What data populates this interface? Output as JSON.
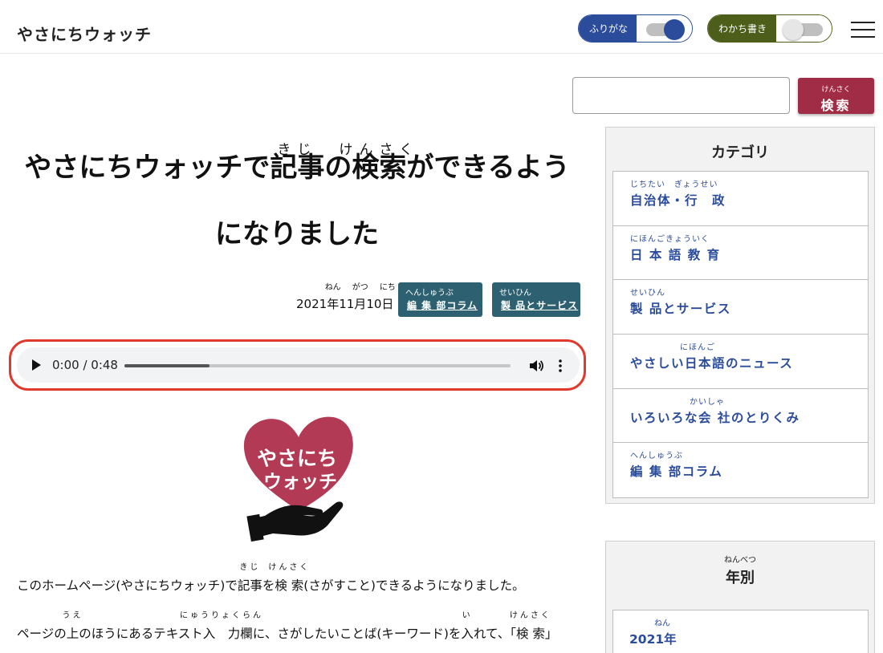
{
  "header": {
    "site_title": "やさにちウォッチ",
    "furigana_toggle": {
      "label": "ふりがな",
      "state": "on",
      "color": "#2b4c9b"
    },
    "wakachi_toggle": {
      "label": "わかち書き",
      "state": "off",
      "color": "#4c5e1a"
    },
    "menu_icon": "hamburger-menu-icon"
  },
  "search": {
    "input_value": "",
    "button_ruby": "けんさく",
    "button_label": "検索",
    "button_color": "#a12c45"
  },
  "article": {
    "title": {
      "part1": "やさにちウォッチで",
      "word1": "記事",
      "word1_ruby": "きじ",
      "part2": "の",
      "word2": "検索",
      "word2_ruby": "けんさく",
      "part3": "ができるよう",
      "line2": "になりました"
    },
    "date": {
      "year": "2021",
      "year_unit": "年",
      "year_unit_ruby": "ねん",
      "month": "11",
      "month_unit": "月",
      "month_unit_ruby": "がつ",
      "day": "10",
      "day_unit": "日",
      "day_unit_ruby": "にち"
    },
    "tags": [
      {
        "ruby": "へんしゅうぶ",
        "label": "編 集 部コラム"
      },
      {
        "ruby": "せいひん",
        "label": "製 品とサービス"
      }
    ],
    "audio": {
      "time_display": "0:00 / 0:48",
      "progress_fraction": 0.22,
      "play_icon": "play-icon",
      "volume_icon": "volume-icon",
      "more_icon": "more-options-icon"
    },
    "logo_text_line1": "やさにち",
    "logo_text_line2": "ウォッチ",
    "paragraph1": {
      "before": "このホームページ(やさにちウォッチ)で",
      "word1": "記事",
      "word1_ruby": "きじ",
      "mid": "を",
      "word2": "検 索",
      "word2_ruby": "けんさく",
      "after": "(さがすこと)できるようになりました。"
    },
    "paragraph2": {
      "before": "ページの",
      "word1": "上",
      "word1_ruby": "うえ",
      "mid1": "のほうにあるテキスト",
      "word2": "入　力",
      "word2_ruby": "にゅうりょくらん",
      "mid2": "欄に、さがしたいことば(キーワード)を",
      "word3": "入",
      "word3_ruby": "い",
      "mid3": "れて、「",
      "word4": "検 索",
      "word4_ruby": "けんさく",
      "after": "」"
    }
  },
  "sidebar": {
    "category_title": "カテゴリ",
    "categories": [
      {
        "ruby": "じちたい　ぎょうせい",
        "label": "自治体・行　政"
      },
      {
        "ruby": "にほんごきょういく",
        "label": "日 本 語 教 育"
      },
      {
        "ruby": "せいひん",
        "label": "製 品とサービス"
      },
      {
        "ruby": "にほんご",
        "label": "やさしい日本語のニュース"
      },
      {
        "ruby": "かいしゃ",
        "label": "いろいろな会 社のとりくみ"
      },
      {
        "ruby": "へんしゅうぶ",
        "label": "編 集 部コラム"
      }
    ],
    "yearly_title_ruby": "ねんべつ",
    "yearly_title": "年別",
    "years": [
      {
        "ruby": "ねん",
        "label": "2021年"
      }
    ]
  }
}
